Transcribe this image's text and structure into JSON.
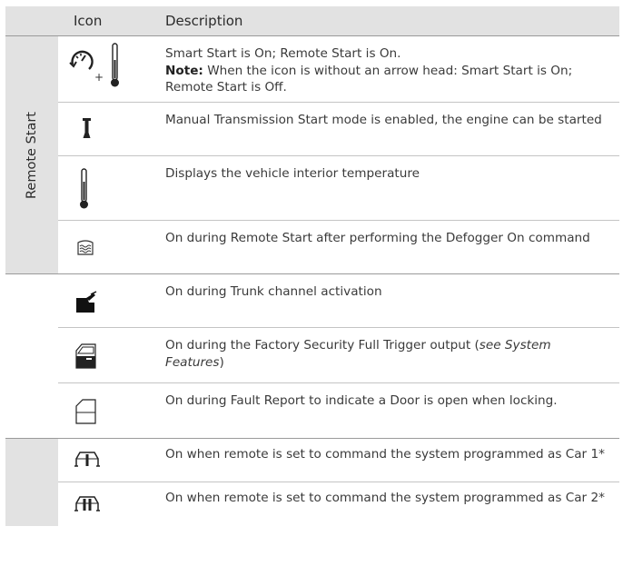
{
  "header": {
    "icon": "Icon",
    "description": "Description"
  },
  "sections": [
    {
      "label": "Remote Start",
      "rows": [
        {
          "icon": "smart-start-plus-thermometer-icon",
          "line1": "Smart Start is On; Remote Start is On.",
          "note_label": "Note:",
          "note_text": " When the icon is without an arrow head: Smart Start is On; Remote Start is Off."
        },
        {
          "icon": "manual-transmission-icon",
          "text": "Manual Transmission Start mode is enabled, the engine can be started"
        },
        {
          "icon": "thermometer-icon",
          "text": "Displays the vehicle interior temperature"
        },
        {
          "icon": "defogger-icon",
          "text": "On during Remote Start after performing the  Defogger On command"
        }
      ]
    },
    {
      "label": "",
      "rows": [
        {
          "icon": "trunk-open-icon",
          "text": "On during Trunk channel activation"
        },
        {
          "icon": "door-full-trigger-icon",
          "text_pre": "On during the Factory Security Full Trigger output (",
          "text_italic": "see System Features",
          "text_post": ")"
        },
        {
          "icon": "door-open-icon",
          "text": "On during Fault Report to indicate a Door is open when locking."
        }
      ]
    },
    {
      "label": "",
      "rows": [
        {
          "icon": "car-1-icon",
          "text": "On when remote is set to command the system programmed as Car 1*"
        },
        {
          "icon": "car-2-icon",
          "text": "On when remote is set to command the system programmed as Car 2*"
        }
      ]
    }
  ],
  "plus_sign": "+",
  "colors": {
    "header_bg": "#e2e2e2",
    "rule": "#9a9a9a",
    "text": "#3a3a3a"
  }
}
